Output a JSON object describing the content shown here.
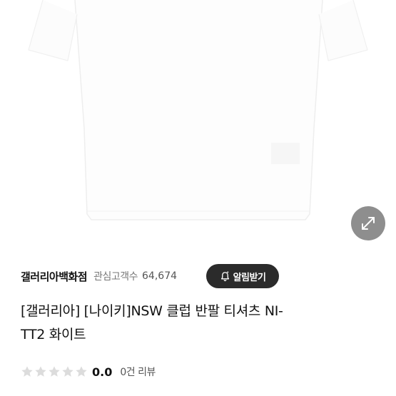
{
  "product": {
    "image_alt": "white t-shirt",
    "store_name": "갤러리아백화점",
    "favorite_label": "관심고객수",
    "favorite_count": "64,674",
    "alert_button_label": "알림받기",
    "title_line1": "[갤러리아] [나이키]NSW 클럽 반팔 티셔츠 NI-",
    "title_line2": "TT2 화이트",
    "rating_stars_filled": 0,
    "rating_stars_total": 5,
    "rating_score": "0.0",
    "review_count": "0건 리뷰"
  },
  "colors": {
    "alert_button_bg": "#2b2b2b",
    "expand_button_bg": "#8e8e8e",
    "star_empty": "#dcdcdc"
  },
  "icons": {
    "expand": "expand-arrows-icon",
    "bell": "bell-icon",
    "star": "star-icon"
  }
}
